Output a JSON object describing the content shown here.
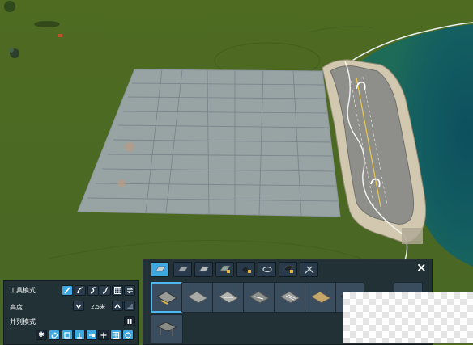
{
  "scene": {
    "description_icons": [
      "grid-tile",
      "quay-wharf",
      "tree",
      "ocean"
    ]
  },
  "toolbar": {
    "tabs": [
      {
        "icon": "road-piece-icon",
        "locked": false,
        "active": true
      },
      {
        "icon": "road-piece-icon",
        "locked": false,
        "active": false
      },
      {
        "icon": "road-piece-icon",
        "locked": false,
        "active": false
      },
      {
        "icon": "road-lock-icon",
        "locked": true,
        "active": false
      },
      {
        "icon": "road-lock-icon",
        "locked": true,
        "active": false
      },
      {
        "icon": "roundabout-icon",
        "locked": false,
        "active": false
      },
      {
        "icon": "dark-road-lock-icon",
        "locked": true,
        "active": false
      },
      {
        "icon": "tools-icon",
        "locked": false,
        "active": false
      }
    ],
    "close_icon": "×",
    "items": [
      {
        "icon": "gravel-road-icon",
        "active": true
      },
      {
        "icon": "two-lane-road-icon",
        "active": false
      },
      {
        "icon": "road-with-lanes-icon",
        "active": false
      },
      {
        "icon": "four-lane-road-icon",
        "active": false
      },
      {
        "icon": "highway-road-icon",
        "active": false
      },
      {
        "icon": "sand-road-icon",
        "active": false
      },
      {
        "icon": "dark-road-icon",
        "active": false
      },
      {
        "icon": "dark-road-icon",
        "active": false
      }
    ],
    "second_row_items": [
      {
        "icon": "bridge-icon",
        "active": false
      }
    ]
  },
  "tool_options": {
    "tool_mode_label": "工具模式",
    "height_label": "高度",
    "height_value": "2.5米",
    "parallel_mode_label": "并列模式",
    "tool_mode_buttons": [
      "straight-road-icon",
      "curve-road-icon",
      "freeform-road-icon",
      "smooth-curve-icon",
      "grid-icon",
      "replace-icon"
    ],
    "parallel_buttons": [
      "star-icon",
      "eraser-icon",
      "square-icon",
      "t-junction-icon",
      "end-icon",
      "cross-icon",
      "grid-small-icon",
      "circle-icon"
    ]
  }
}
